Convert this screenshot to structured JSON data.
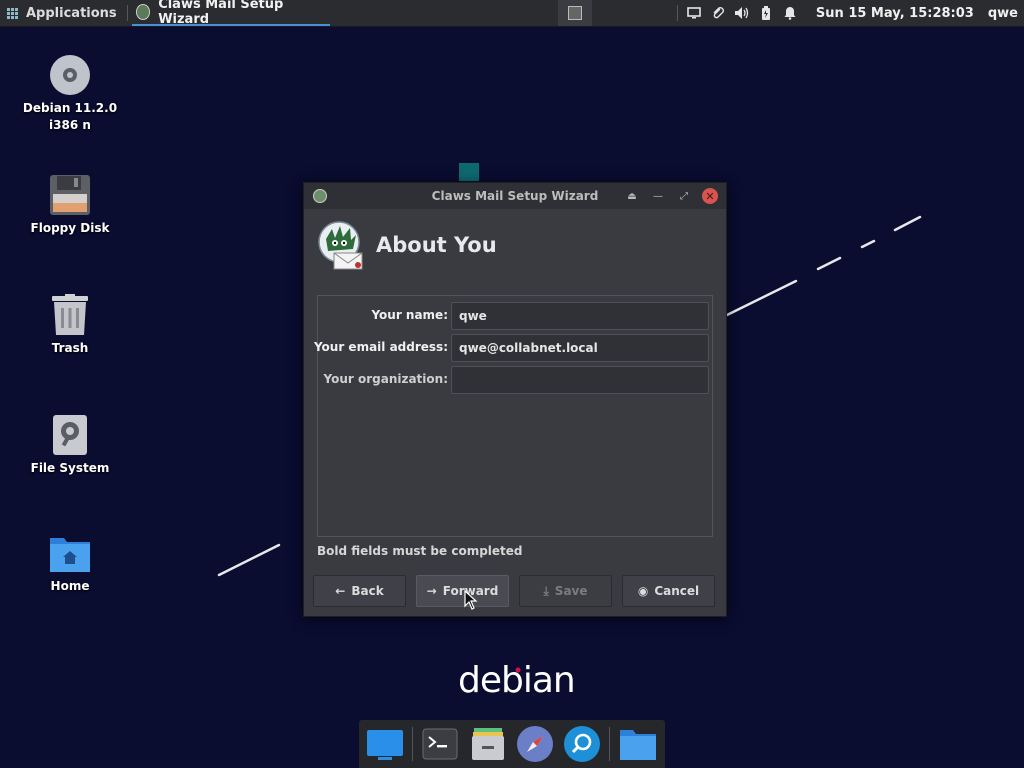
{
  "panel": {
    "applications_label": "Applications",
    "task_label": "Claws Mail Setup Wizard",
    "clock": "Sun 15 May, 15:28:03",
    "user": "qwe"
  },
  "desktop": {
    "icons": [
      {
        "label": "Debian 11.2.0\ni386 n",
        "icon": "disc-icon"
      },
      {
        "label": "Floppy Disk",
        "icon": "floppy-icon"
      },
      {
        "label": "Trash",
        "icon": "trash-icon"
      },
      {
        "label": "File System",
        "icon": "hard-drive-icon"
      },
      {
        "label": "Home",
        "icon": "home-folder-icon"
      }
    ],
    "debian_logo_text": "debian"
  },
  "dialog": {
    "window_title": "Claws Mail Setup Wizard",
    "header_title": "About You",
    "fields": [
      {
        "label": "Your name:",
        "value": "qwe",
        "required": true
      },
      {
        "label": "Your email address:",
        "value": "qwe@collabnet.local",
        "required": true
      },
      {
        "label": "Your organization:",
        "value": "",
        "required": false
      }
    ],
    "note": "Bold fields must be completed",
    "buttons": {
      "back": "Back",
      "forward": "Forward",
      "save": "Save",
      "cancel": "Cancel"
    }
  },
  "dock": {
    "items": [
      "desktop-icon",
      "terminal-icon",
      "file-manager-icon",
      "web-browser-icon",
      "search-icon",
      "folder-icon"
    ]
  },
  "colors": {
    "desktop_bg": "#0a0c30",
    "panel_bg": "#2b2c30",
    "dialog_bg": "#3a3b41",
    "accent": "#4a90d9",
    "close": "#d9534f"
  }
}
